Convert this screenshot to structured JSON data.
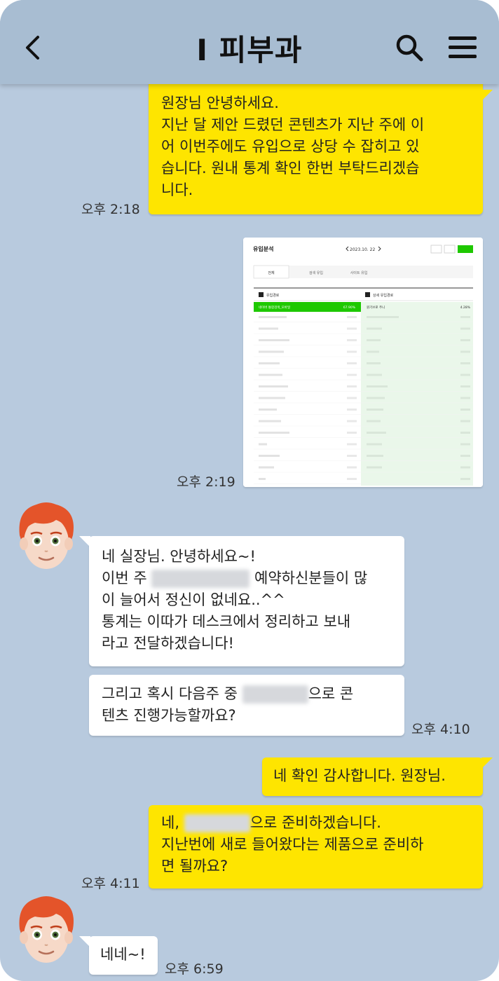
{
  "header": {
    "title": "I 피부과"
  },
  "messages": [
    {
      "side": "right",
      "text": "원장님 안녕하세요.\n지난 달 제안 드렸던 콘텐츠가 지난 주에 이\n어 이번주에도 유입으로 상당 수 잡히고 있\n습니다. 원내 통계 확인 한번 부탁드리겠습\n니다.",
      "time": "오후 2:18"
    },
    {
      "side": "right",
      "type": "image",
      "time": "오후 2:19",
      "image": {
        "title": "유입분석",
        "date": "2023.10. 22",
        "tabs": [
          "전체",
          "검색 유입",
          "사이트 유입"
        ],
        "left_header": "유입경로",
        "right_header": "상세 유입경로",
        "highlight_left": "네이버 통합검색_모바일",
        "highlight_left_value": "67.90%",
        "highlight_right": "원기브로 주니",
        "highlight_right_value": "4.28%"
      }
    },
    {
      "side": "left",
      "parts": [
        "네 실장님. 안녕하세요~!\n이번 주 ",
        "예약하신분들이 많\n이 늘어서 정신이 없네요..^^\n통계는 이따가 데스크에서 정리하고 보내\n라고 전달하겠습니다!"
      ]
    },
    {
      "side": "left",
      "parts": [
        "그리고 혹시 다음주 중 ",
        "으로 콘\n텐츠 진행가능할까요?"
      ],
      "time": "오후 4:10"
    },
    {
      "side": "right",
      "text": "네 확인 감사합니다. 원장님."
    },
    {
      "side": "right",
      "parts": [
        "네, ",
        "으로 준비하겠습니다.\n지난번에 새로 들어왔다는 제품으로 준비하\n면 될까요?"
      ],
      "time": "오후 4:11"
    },
    {
      "side": "left",
      "text": "네네~!",
      "time": "오후 6:59"
    }
  ],
  "colors": {
    "background": "#b8cade",
    "header": "#a8bdd2",
    "my_bubble": "#fee500",
    "their_bubble": "#ffffff",
    "accent_green": "#1ec800"
  }
}
